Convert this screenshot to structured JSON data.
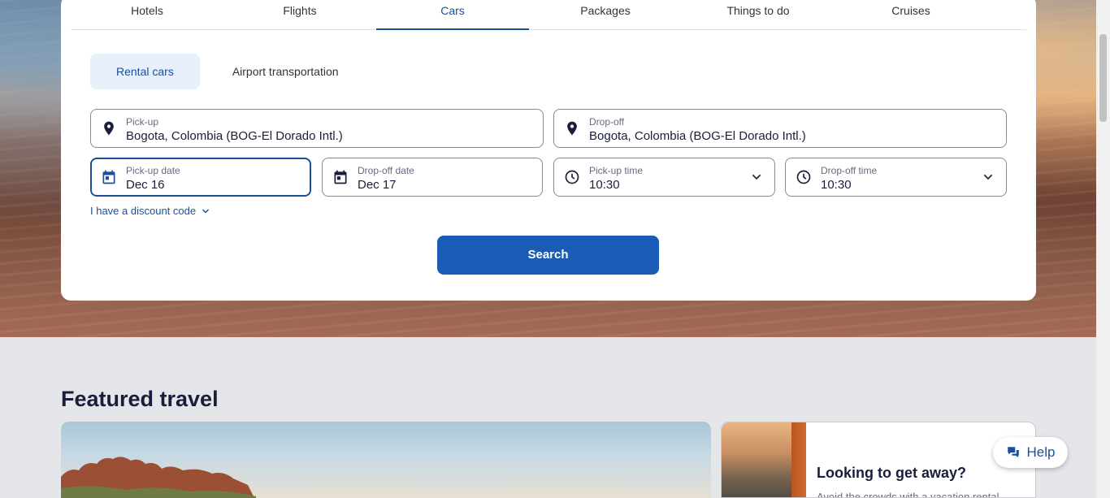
{
  "nav_tabs": [
    {
      "label": "Hotels"
    },
    {
      "label": "Flights"
    },
    {
      "label": "Cars"
    },
    {
      "label": "Packages"
    },
    {
      "label": "Things to do"
    },
    {
      "label": "Cruises"
    }
  ],
  "active_tab": "Cars",
  "subtabs": [
    {
      "label": "Rental cars"
    },
    {
      "label": "Airport transportation"
    }
  ],
  "pickup": {
    "label": "Pick-up",
    "value": "Bogota, Colombia (BOG-El Dorado Intl.)",
    "icon": "map-pin-icon"
  },
  "dropoff": {
    "label": "Drop-off",
    "value": "Bogota, Colombia (BOG-El Dorado Intl.)",
    "icon": "map-pin-icon"
  },
  "pickup_date": {
    "label": "Pick-up date",
    "value": "Dec 16",
    "icon": "calendar-icon"
  },
  "dropoff_date": {
    "label": "Drop-off date",
    "value": "Dec 17",
    "icon": "calendar-icon"
  },
  "pickup_time": {
    "label": "Pick-up time",
    "value": "10:30",
    "icon": "clock-icon"
  },
  "dropoff_time": {
    "label": "Drop-off time",
    "value": "10:30",
    "icon": "clock-icon"
  },
  "discount_link": "I have a discount code",
  "search_button": "Search",
  "featured": {
    "title": "Featured travel",
    "card_title": "Looking to get away?",
    "card_text": "Avoid the crowds with a vacation rental"
  },
  "help_button": "Help",
  "colors": {
    "accent": "#1a4f9c",
    "button": "#1a5cb5",
    "page_bg": "#e4e6e9"
  }
}
